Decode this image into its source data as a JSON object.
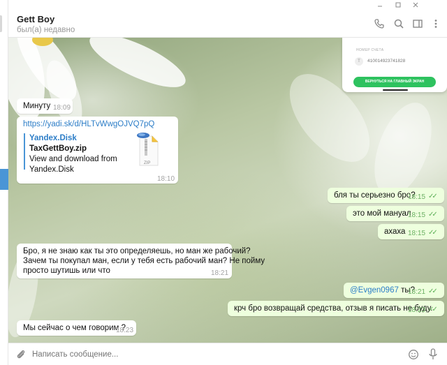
{
  "header": {
    "contact_name": "Gett Boy",
    "contact_status": "был(а) недавно"
  },
  "wallpaper_card": {
    "account_label": "НОМЕР СЧЕТА",
    "account_icon_letter": "T",
    "account_number": "410014923741828",
    "button_label": "ВЕРНУТЬСЯ НА ГЛАВНЫЙ ЭКРАН"
  },
  "messages": [
    {
      "dir": "in",
      "text": "Минуту",
      "time": "18:09"
    },
    {
      "dir": "in",
      "link": "https://yadi.sk/d/HLTvWwgOJVQ7pQ",
      "preview_site": "Yandex.Disk",
      "preview_title": "TaxGettBoy.zip",
      "preview_desc_1": "View and download from",
      "preview_desc_2": "Yandex.Disk",
      "file_badge": "ZIP",
      "time": "18:10"
    },
    {
      "dir": "out",
      "text": "бля ты серьезно бро?",
      "time": "18:15"
    },
    {
      "dir": "out",
      "text": "это мой мануал",
      "time": "18:15"
    },
    {
      "dir": "out",
      "text": "ахаха",
      "time": "18:15"
    },
    {
      "dir": "in",
      "line1": "Бро, я не знаю как ты это определяешь, но ман же рабочий?",
      "line2": "Зачем ты покупал ман, если у тебя есть рабочий ман? Не пойму",
      "line3": "просто шутишь или что",
      "time": "18:21"
    },
    {
      "dir": "out",
      "mention": "@Evgen0967",
      "text": " ты?",
      "time": "18:21"
    },
    {
      "dir": "out",
      "text": "крч бро возвращай средства, отзыв я писать не буду.",
      "time": "18:23"
    },
    {
      "dir": "in",
      "text": "Мы сейчас о чем говорим ?",
      "time": "18:23"
    }
  ],
  "composer": {
    "placeholder": "Написать сообщение..."
  },
  "colors": {
    "accent": "#4a95d6",
    "outgoing_bubble": "#eeffde",
    "check": "#5cb056"
  }
}
